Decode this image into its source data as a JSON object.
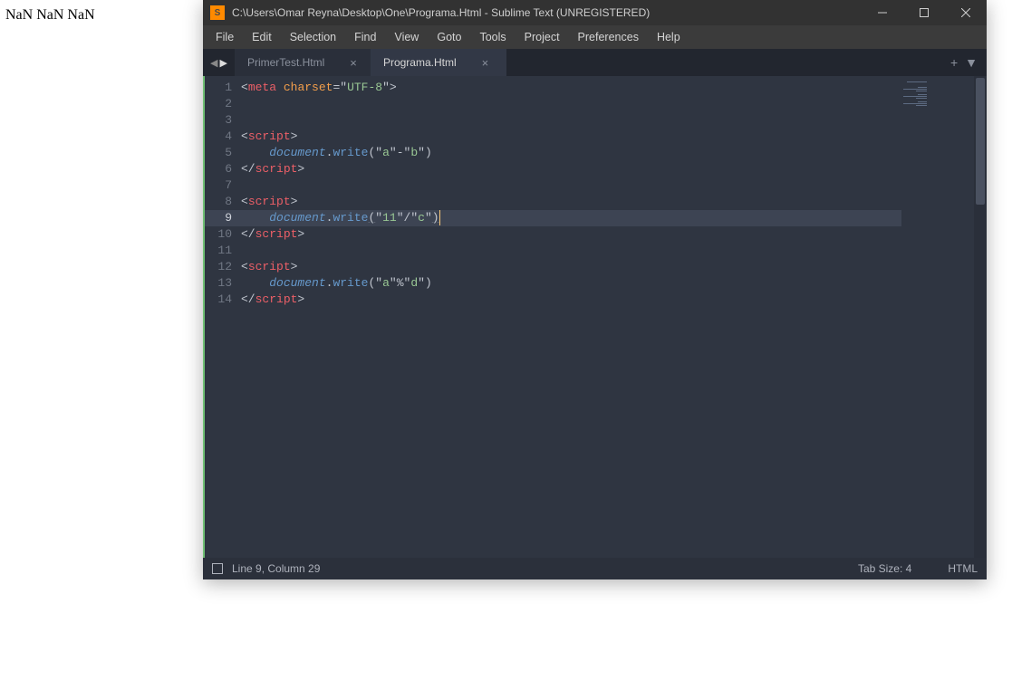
{
  "browser_output": "NaN NaN NaN",
  "titlebar": {
    "path": "C:\\Users\\Omar Reyna\\Desktop\\One\\Programa.Html - Sublime Text (UNREGISTERED)"
  },
  "menu": [
    "File",
    "Edit",
    "Selection",
    "Find",
    "View",
    "Goto",
    "Tools",
    "Project",
    "Preferences",
    "Help"
  ],
  "tabs": [
    {
      "label": "PrimerTest.Html",
      "active": false
    },
    {
      "label": "Programa.Html",
      "active": true
    }
  ],
  "editor": {
    "line_count": 14,
    "current_line": 9,
    "lines": [
      {
        "n": 1,
        "tokens": [
          [
            "p-punc",
            "<"
          ],
          [
            "p-tag",
            "meta"
          ],
          [
            "p-punc",
            " "
          ],
          [
            "p-attr",
            "charset"
          ],
          [
            "p-op",
            "="
          ],
          [
            "p-punc",
            "\""
          ],
          [
            "p-str",
            "UTF-8"
          ],
          [
            "p-punc",
            "\""
          ],
          [
            "p-punc",
            ">"
          ]
        ]
      },
      {
        "n": 2,
        "tokens": []
      },
      {
        "n": 3,
        "tokens": []
      },
      {
        "n": 4,
        "tokens": [
          [
            "p-punc",
            "<"
          ],
          [
            "p-tag",
            "script"
          ],
          [
            "p-punc",
            ">"
          ]
        ]
      },
      {
        "n": 5,
        "tokens": [
          [
            "p-guide",
            "    "
          ],
          [
            "p-obj",
            "document"
          ],
          [
            "p-punc",
            "."
          ],
          [
            "p-func",
            "write"
          ],
          [
            "p-punc",
            "("
          ],
          [
            "p-punc",
            "\""
          ],
          [
            "p-str",
            "a"
          ],
          [
            "p-punc",
            "\""
          ],
          [
            "p-op",
            "-"
          ],
          [
            "p-punc",
            "\""
          ],
          [
            "p-str",
            "b"
          ],
          [
            "p-punc",
            "\""
          ],
          [
            "p-punc",
            ")"
          ]
        ]
      },
      {
        "n": 6,
        "tokens": [
          [
            "p-punc",
            "</"
          ],
          [
            "p-tag",
            "script"
          ],
          [
            "p-punc",
            ">"
          ]
        ]
      },
      {
        "n": 7,
        "tokens": []
      },
      {
        "n": 8,
        "tokens": [
          [
            "p-punc",
            "<"
          ],
          [
            "p-tag",
            "script"
          ],
          [
            "p-punc",
            ">"
          ]
        ]
      },
      {
        "n": 9,
        "tokens": [
          [
            "p-guide",
            "    "
          ],
          [
            "p-obj",
            "document"
          ],
          [
            "p-punc",
            "."
          ],
          [
            "p-func",
            "write"
          ],
          [
            "p-punc underline",
            "("
          ],
          [
            "p-punc",
            "\""
          ],
          [
            "p-str",
            "11"
          ],
          [
            "p-punc",
            "\""
          ],
          [
            "p-op",
            "/"
          ],
          [
            "p-punc",
            "\""
          ],
          [
            "p-str",
            "c"
          ],
          [
            "p-punc",
            "\""
          ],
          [
            "p-punc underline",
            ")"
          ]
        ]
      },
      {
        "n": 10,
        "tokens": [
          [
            "p-punc",
            "</"
          ],
          [
            "p-tag",
            "script"
          ],
          [
            "p-punc",
            ">"
          ]
        ]
      },
      {
        "n": 11,
        "tokens": []
      },
      {
        "n": 12,
        "tokens": [
          [
            "p-punc",
            "<"
          ],
          [
            "p-tag",
            "script"
          ],
          [
            "p-punc",
            ">"
          ]
        ]
      },
      {
        "n": 13,
        "tokens": [
          [
            "p-guide",
            "    "
          ],
          [
            "p-obj",
            "document"
          ],
          [
            "p-punc",
            "."
          ],
          [
            "p-func",
            "write"
          ],
          [
            "p-punc",
            "("
          ],
          [
            "p-punc",
            "\""
          ],
          [
            "p-str",
            "a"
          ],
          [
            "p-punc",
            "\""
          ],
          [
            "p-op",
            "%"
          ],
          [
            "p-punc",
            "\""
          ],
          [
            "p-str",
            "d"
          ],
          [
            "p-punc",
            "\""
          ],
          [
            "p-punc",
            ")"
          ]
        ]
      },
      {
        "n": 14,
        "tokens": [
          [
            "p-punc",
            "</"
          ],
          [
            "p-tag",
            "script"
          ],
          [
            "p-punc",
            ">"
          ]
        ]
      }
    ]
  },
  "statusbar": {
    "position": "Line 9, Column 29",
    "tab_size": "Tab Size: 4",
    "syntax": "HTML"
  }
}
